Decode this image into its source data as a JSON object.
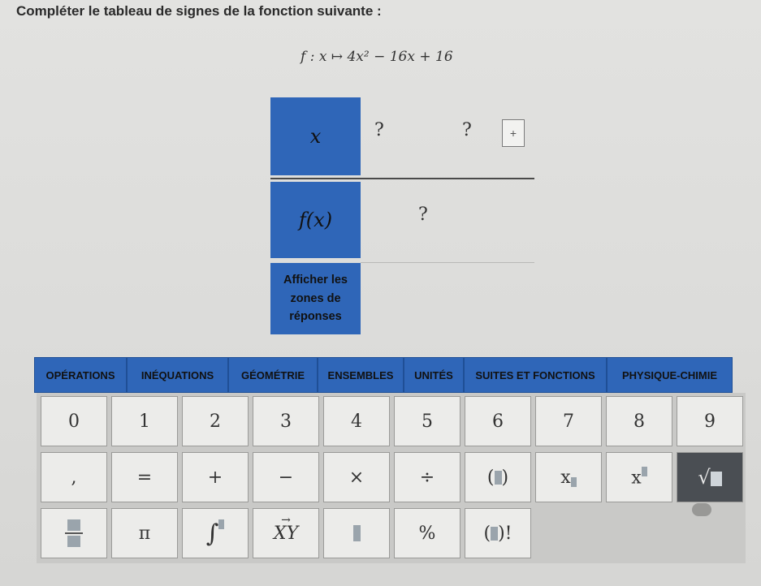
{
  "instruction": "Compléter le tableau de signes de la fonction suivante :",
  "formula": "f : x ↦ 4x² − 16x + 16",
  "sign_table": {
    "x_label": "x",
    "fx_label": "f(x)",
    "x_row_cells": [
      "?",
      "?"
    ],
    "plus_button": "+",
    "fx_row_cells": [
      "?"
    ],
    "show_zones_lines": [
      "Afficher les",
      "zones de",
      "réponses"
    ]
  },
  "tabs": [
    "OPÉRATIONS",
    "INÉQUATIONS",
    "GÉOMÉTRIE",
    "ENSEMBLES",
    "UNITÉS",
    "SUITES ET FONCTIONS",
    "PHYSIQUE-CHIMIE"
  ],
  "keys_row1": [
    "0",
    "1",
    "2",
    "3",
    "4",
    "5",
    "6",
    "7",
    "8",
    "9"
  ],
  "keys_row2": [
    ",",
    "=",
    "+",
    "−",
    "×",
    "÷",
    "()",
    "x",
    "x",
    "√"
  ],
  "keys_row3": [
    "",
    "π",
    "∫",
    "XY",
    "",
    "%",
    "()!"
  ],
  "key_icons": {
    "row2": [
      "comma",
      "equals",
      "plus",
      "minus",
      "times",
      "divide",
      "parentheses-icon",
      "subscript-icon",
      "superscript-icon",
      "square-root-icon"
    ],
    "row3": [
      "fraction-icon",
      "pi",
      "integral-icon",
      "vector-icon",
      "placeholder-icon",
      "percent",
      "factorial-icon"
    ]
  },
  "colors": {
    "accent": "#2f66b8",
    "dark_key": "#4a4e53"
  }
}
